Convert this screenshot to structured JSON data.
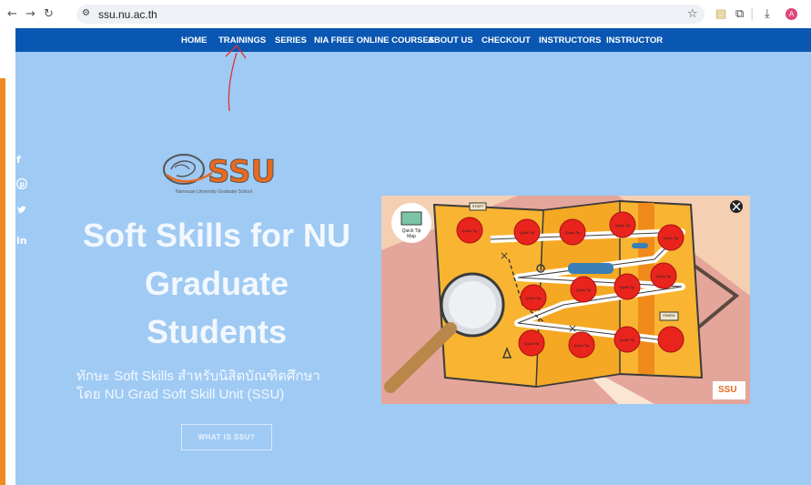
{
  "browser": {
    "url": "ssu.nu.ac.th",
    "avatar_letter": "A",
    "icons": [
      "back-icon",
      "forward-icon",
      "reload-icon",
      "site-settings-icon",
      "bookmark-star-icon",
      "extension-icon",
      "extensions-puzzle-icon",
      "download-icon"
    ]
  },
  "menu": {
    "items": [
      "HOME",
      "TRAININGS",
      "SERIES",
      "NIA FREE ONLINE COURSES",
      "ABOUT US",
      "CHECKOUT",
      "INSTRUCTORS",
      "INSTRUCTOR"
    ]
  },
  "social": [
    "f",
    "℗",
    "🐦",
    "in"
  ],
  "hero": {
    "logo_text": "SSU",
    "logo_caption": "Naresuan University Graduate School",
    "title_line1": "Soft Skills for NU",
    "title_line2": "Graduate",
    "title_line3": "Students",
    "subtitle_line1": "ทักษะ Soft Skills สำหรับนิสิตบัณฑิตศึกษา",
    "subtitle_line2": "โดย NU Grad Soft Skill Unit (SSU)",
    "cta_label": "WHAT IS SSU?"
  },
  "game": {
    "map_label": "Quick Tip Map",
    "tips": [
      "Quick Tip",
      "Quick Tip",
      "Quick Tip",
      "Quick Tip",
      "Quick Tip",
      "Quick Tip",
      "Quick Tip",
      "Quick Tip",
      "Quick Tip",
      "Quick Tip",
      "Quick Tip",
      "Quick Tip"
    ],
    "finish_sign": "FINISH",
    "start_sign": "START",
    "close_label": "×",
    "brand": "SSU"
  },
  "colors": {
    "menubar": "#0a57b3",
    "page_bg": "#9fcaf4",
    "accent_strip": "#ef8a23",
    "tip_ball": "#e8241d",
    "annotation_arrow": "#e0322a"
  }
}
